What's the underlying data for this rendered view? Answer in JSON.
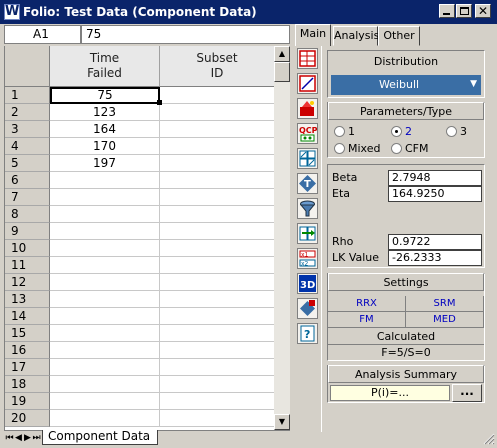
{
  "window": {
    "app_icon": "W",
    "title": "Folio: Test Data (Component Data)",
    "buttons": [
      "minimize",
      "maximize",
      "close"
    ]
  },
  "formula_bar": {
    "cell_ref": "A1",
    "cell_value": "75"
  },
  "sheet": {
    "columns": [
      {
        "line1": "Time",
        "line2": "Failed"
      },
      {
        "line1": "Subset",
        "line2": "ID"
      }
    ],
    "rows": [
      {
        "num": "1",
        "a": "75",
        "b": ""
      },
      {
        "num": "2",
        "a": "123",
        "b": ""
      },
      {
        "num": "3",
        "a": "164",
        "b": ""
      },
      {
        "num": "4",
        "a": "170",
        "b": ""
      },
      {
        "num": "5",
        "a": "197",
        "b": ""
      },
      {
        "num": "6",
        "a": "",
        "b": ""
      },
      {
        "num": "7",
        "a": "",
        "b": ""
      },
      {
        "num": "8",
        "a": "",
        "b": ""
      },
      {
        "num": "9",
        "a": "",
        "b": ""
      },
      {
        "num": "10",
        "a": "",
        "b": ""
      },
      {
        "num": "11",
        "a": "",
        "b": ""
      },
      {
        "num": "12",
        "a": "",
        "b": ""
      },
      {
        "num": "13",
        "a": "",
        "b": ""
      },
      {
        "num": "14",
        "a": "",
        "b": ""
      },
      {
        "num": "15",
        "a": "",
        "b": ""
      },
      {
        "num": "16",
        "a": "",
        "b": ""
      },
      {
        "num": "17",
        "a": "",
        "b": ""
      },
      {
        "num": "18",
        "a": "",
        "b": ""
      },
      {
        "num": "19",
        "a": "",
        "b": ""
      },
      {
        "num": "20",
        "a": "",
        "b": ""
      }
    ],
    "sheet_tab": "Component Data",
    "nav_arrows": [
      "⏮",
      "◀",
      "▶",
      "⏭"
    ]
  },
  "tool_icons": [
    "data-sheet-icon",
    "plot-icon",
    "wizard-icon",
    "qcp-calculator-icon",
    "batch-plot-icon",
    "analytical-test-icon",
    "filter-icon",
    "transfer-life-data-icon",
    "conversion-icon",
    "3d-plot-icon",
    "diamond-tool-icon",
    "help-icon"
  ],
  "tabs": [
    {
      "label": "Main",
      "active": true
    },
    {
      "label": "Analysis",
      "active": false
    },
    {
      "label": "Other",
      "active": false
    }
  ],
  "main_panel": {
    "distribution_label": "Distribution",
    "distribution_value": "Weibull",
    "params_label": "Parameters/Type",
    "radios": [
      {
        "label": "1",
        "checked": false,
        "color": "#000000"
      },
      {
        "label": "2",
        "checked": true,
        "color": "#0000c0"
      },
      {
        "label": "3",
        "checked": false,
        "color": "#000000"
      },
      {
        "label": "Mixed",
        "checked": false,
        "color": "#000000"
      },
      {
        "label": "CFM",
        "checked": false,
        "color": "#000000"
      }
    ],
    "params": [
      {
        "label": "Beta",
        "value": "2.7948"
      },
      {
        "label": "Eta",
        "value": "164.9250"
      }
    ],
    "fit": [
      {
        "label": "Rho",
        "value": "0.9722"
      },
      {
        "label": "LK Value",
        "value": "-26.2333"
      }
    ],
    "settings_label": "Settings",
    "settings": [
      "RRX",
      "SRM",
      "FM",
      "MED"
    ],
    "calculated_label": "Calculated",
    "calculated_value": "F=5/S=0",
    "summary_label": "Analysis Summary",
    "summary_value": "P(i)=...",
    "more_button": "..."
  },
  "colors": {
    "titlebar": "#0a246a",
    "face": "#d4d0c8",
    "dropdown": "#3a6ea5",
    "settings_text": "#0000c0",
    "summary_bg": "#ffffe1"
  }
}
